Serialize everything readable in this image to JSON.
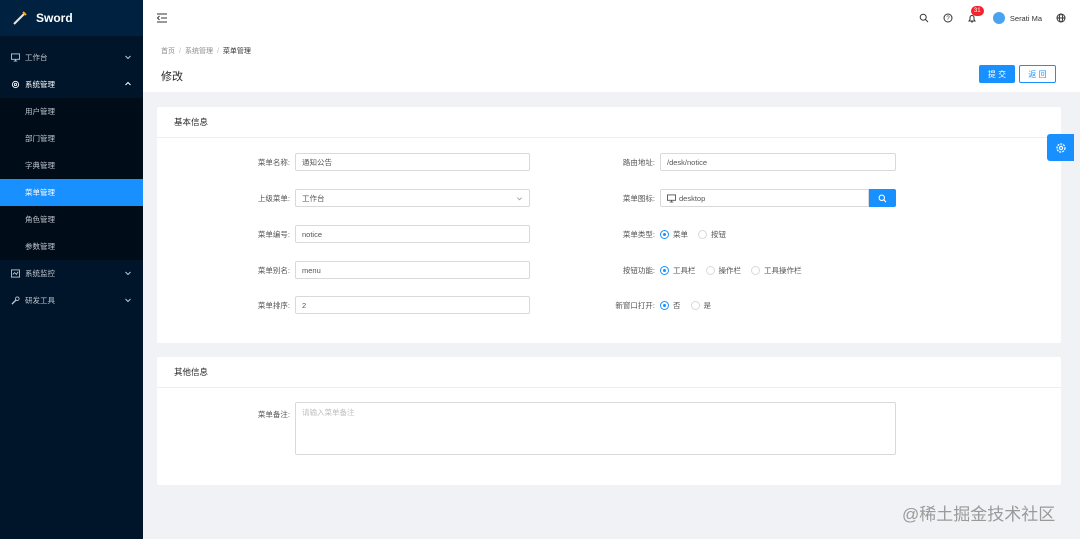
{
  "app": {
    "title": "Sword"
  },
  "sidebar": {
    "items": [
      {
        "label": "工作台"
      },
      {
        "label": "系统管理"
      },
      {
        "label": "系统监控"
      },
      {
        "label": "研发工具"
      }
    ],
    "sub_items": [
      {
        "label": "用户管理"
      },
      {
        "label": "部门管理"
      },
      {
        "label": "字典管理"
      },
      {
        "label": "菜单管理"
      },
      {
        "label": "角色管理"
      },
      {
        "label": "参数管理"
      }
    ]
  },
  "header": {
    "notification_count": "31",
    "username": "Serati Ma"
  },
  "breadcrumb": {
    "home": "首页",
    "parent": "系统管理",
    "current": "菜单管理"
  },
  "page": {
    "title": "修改",
    "submit_label": "提 交",
    "back_label": "返 回"
  },
  "basic": {
    "title": "基本信息",
    "menu_name_label": "菜单名称:",
    "menu_name": "通知公告",
    "route_label": "路由地址:",
    "route": "/desk/notice",
    "parent_label": "上级菜单:",
    "parent": "工作台",
    "icon_label": "菜单图标:",
    "icon": "desktop",
    "code_label": "菜单编号:",
    "code": "notice",
    "type_label": "菜单类型:",
    "type_options": [
      "菜单",
      "按钮"
    ],
    "type_selected": "菜单",
    "alias_label": "菜单别名:",
    "alias": "menu",
    "action_label": "按钮功能:",
    "action_options": [
      "工具栏",
      "操作栏",
      "工具操作栏"
    ],
    "action_selected": "工具栏",
    "sort_label": "菜单排序:",
    "sort": "2",
    "newwin_label": "新窗口打开:",
    "newwin_options": [
      "否",
      "是"
    ],
    "newwin_selected": "否"
  },
  "other": {
    "title": "其他信息",
    "remark_label": "菜单备注:",
    "remark_placeholder": "请输入菜单备注"
  },
  "watermark": "@稀土掘金技术社区"
}
